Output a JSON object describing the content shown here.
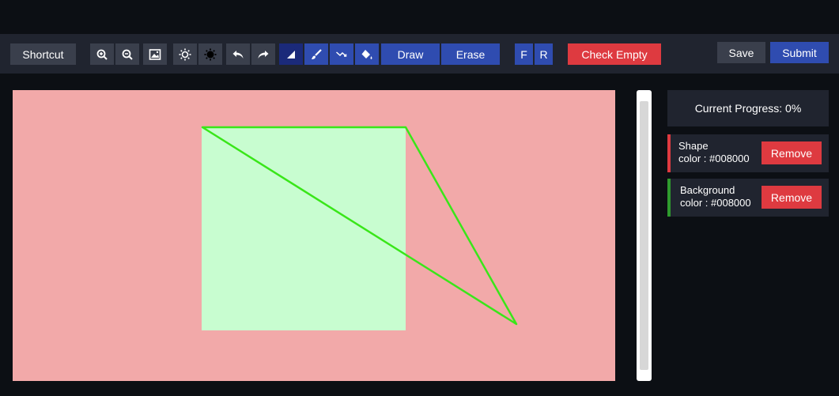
{
  "toolbar": {
    "shortcut_label": "Shortcut",
    "draw_label": "Draw",
    "erase_label": "Erase",
    "f_label": "F",
    "r_label": "R",
    "check_empty_label": "Check Empty",
    "save_label": "Save",
    "submit_label": "Submit",
    "icons": [
      "zoom-in-icon",
      "zoom-out-icon",
      "image-icon",
      "brightness-up-icon",
      "brightness-down-icon",
      "undo-icon",
      "redo-icon",
      "polygon-tool-icon",
      "brush-icon",
      "line-tool-icon",
      "fill-bucket-icon"
    ]
  },
  "side_panel": {
    "progress_text": "Current Progress: 0%",
    "layers": [
      {
        "line1": "Shape",
        "line2": "color : #008000",
        "remove_label": "Remove",
        "accent": "#de3a40"
      },
      {
        "line1": "Background",
        "line2": "color : #008000",
        "remove_label": "Remove",
        "accent": "#2e9a2e"
      }
    ]
  },
  "canvas": {
    "background_color": "#f2a9a9",
    "rect_fill": "#c8fdd0",
    "stroke_color": "#39e619"
  }
}
